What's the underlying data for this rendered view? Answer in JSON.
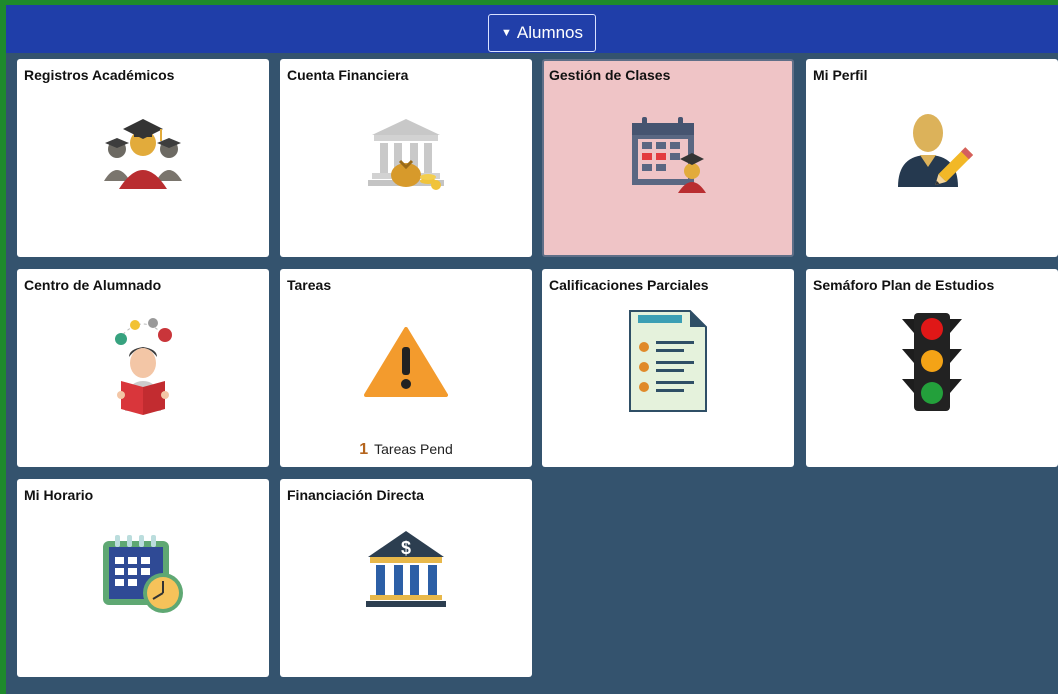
{
  "header": {
    "nav_label": "Alumnos",
    "caret_icon": "caret-down-icon"
  },
  "tiles": [
    {
      "title": "Registros Académicos",
      "icon": "graduates-icon"
    },
    {
      "title": "Cuenta Financiera",
      "icon": "bank-money-icon"
    },
    {
      "title": "Gestión de Clases",
      "icon": "calendar-graduate-icon",
      "selected": true
    },
    {
      "title": "Mi Perfil",
      "icon": "user-edit-icon"
    },
    {
      "title": "Centro de Alumnado",
      "icon": "student-reading-icon"
    },
    {
      "title": "Tareas",
      "icon": "warning-icon",
      "pending_count": "1",
      "pending_label": "Tareas Pend"
    },
    {
      "title": "Calificaciones Parciales",
      "icon": "checklist-document-icon"
    },
    {
      "title": "Semáforo Plan de Estudios",
      "icon": "traffic-light-icon"
    },
    {
      "title": "Mi Horario",
      "icon": "calendar-clock-icon"
    },
    {
      "title": "Financiación Directa",
      "icon": "bank-dollar-icon"
    }
  ],
  "colors": {
    "topbar": "#1f3ea9",
    "background": "#34536e",
    "selected_tile": "#efc4c6",
    "frame": "#1e8a2c"
  }
}
